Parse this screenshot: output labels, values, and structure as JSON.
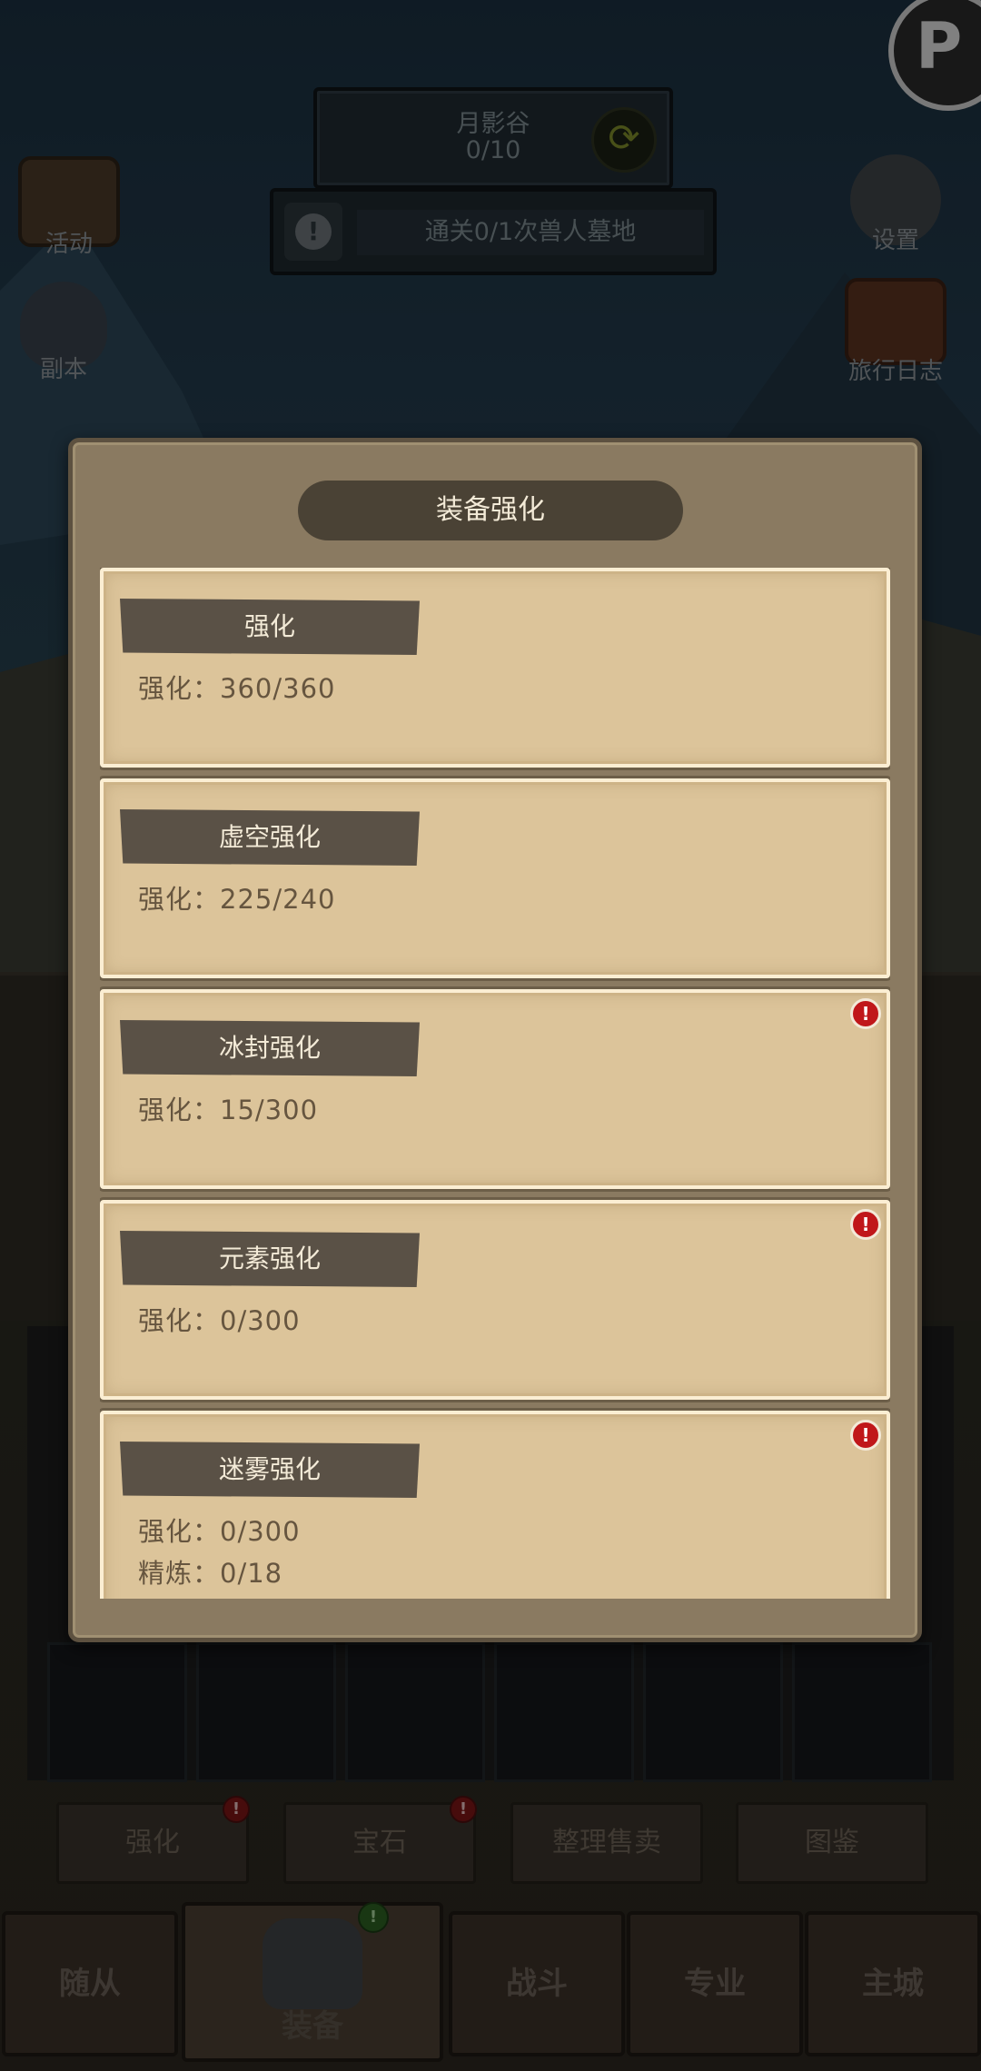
{
  "stage": {
    "name": "月影谷",
    "progress": "0/10",
    "refresh_icon": "refresh-icon"
  },
  "quest": {
    "text": "通关0/1次兽人墓地",
    "icon": "alert-icon"
  },
  "left_menu": [
    {
      "label": "活动",
      "icon": "scroll-icon"
    },
    {
      "label": "副本",
      "icon": "portal-icon"
    }
  ],
  "right_menu": [
    {
      "label": "设置",
      "icon": "gear-icon"
    },
    {
      "label": "旅行日志",
      "icon": "book-icon"
    }
  ],
  "modal": {
    "title": "装备强化",
    "cards": [
      {
        "name": "强化",
        "lines": [
          "强化：360/360"
        ],
        "alert": false
      },
      {
        "name": "虚空强化",
        "lines": [
          "强化：225/240"
        ],
        "alert": false
      },
      {
        "name": "冰封强化",
        "lines": [
          "强化：15/300"
        ],
        "alert": true
      },
      {
        "name": "元素强化",
        "lines": [
          "强化：0/300"
        ],
        "alert": true
      },
      {
        "name": "迷雾强化",
        "lines": [
          "强化：0/300",
          "精炼：0/18"
        ],
        "alert": true
      }
    ],
    "alert_glyph": "!"
  },
  "function_buttons": [
    {
      "label": "强化",
      "badge": "!"
    },
    {
      "label": "宝石",
      "badge": "!"
    },
    {
      "label": "整理售卖",
      "badge": ""
    },
    {
      "label": "图鉴",
      "badge": ""
    }
  ],
  "nav_tabs": [
    {
      "label": "随从"
    },
    {
      "label": "装备",
      "active": true,
      "badge": "!"
    },
    {
      "label": "战斗"
    },
    {
      "label": "专业"
    },
    {
      "label": "主城"
    }
  ],
  "colors": {
    "modal_bg": "#8a7a61",
    "card_bg": "#dcc49a",
    "tag_bg": "#5a5146",
    "alert_red": "#c0171a"
  }
}
